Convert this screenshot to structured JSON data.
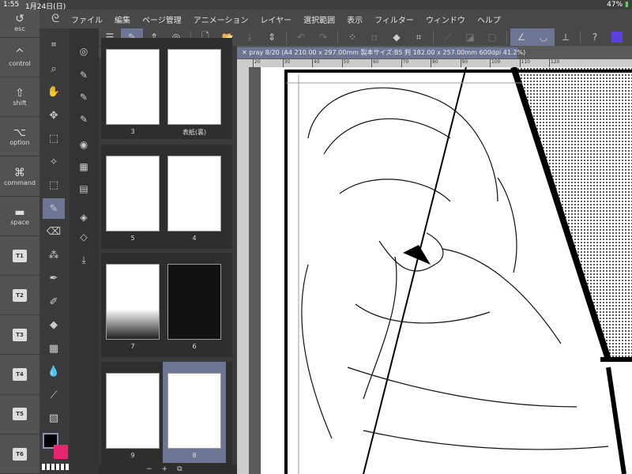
{
  "status": {
    "time": "1:55",
    "date": "1月24日(日)",
    "battery": "47%"
  },
  "menu": [
    "ファイル",
    "編集",
    "ページ管理",
    "アニメーション",
    "レイヤー",
    "選択範囲",
    "表示",
    "フィルター",
    "ウィンドウ",
    "ヘルプ"
  ],
  "keys": [
    {
      "glyph": "↺",
      "label": "esc"
    },
    {
      "glyph": "^",
      "label": "control"
    },
    {
      "glyph": "⇧",
      "label": "shift"
    },
    {
      "glyph": "⌥",
      "label": "option"
    },
    {
      "glyph": "⌘",
      "label": "command"
    },
    {
      "glyph": "▬",
      "label": "space"
    },
    {
      "label": "T1"
    },
    {
      "label": "T2"
    },
    {
      "label": "T3"
    },
    {
      "label": "T4"
    },
    {
      "label": "T5"
    },
    {
      "label": "T6"
    }
  ],
  "pages_panel": {
    "tab": "pray",
    "rows": [
      [
        "3",
        "表紙(裏)"
      ],
      [
        "5",
        "4"
      ],
      [
        "7",
        "6"
      ],
      [
        "9",
        "8"
      ]
    ],
    "zoom_minus": "−",
    "zoom_plus": "+"
  },
  "document_tab": "pray 8/20 (A4 210.00 x 297.00mm 製本サイズ:B5 判 182.00 x 257.00mm 600dpi 41.2%)",
  "ruler": [
    "20",
    "30",
    "40",
    "50",
    "60",
    "70",
    "80",
    "90",
    "100",
    "110",
    "120"
  ],
  "colors": {
    "main": "#000000",
    "sub": "#e8266e",
    "accent": "#6d7595",
    "swatch": "#5b3fe0"
  }
}
